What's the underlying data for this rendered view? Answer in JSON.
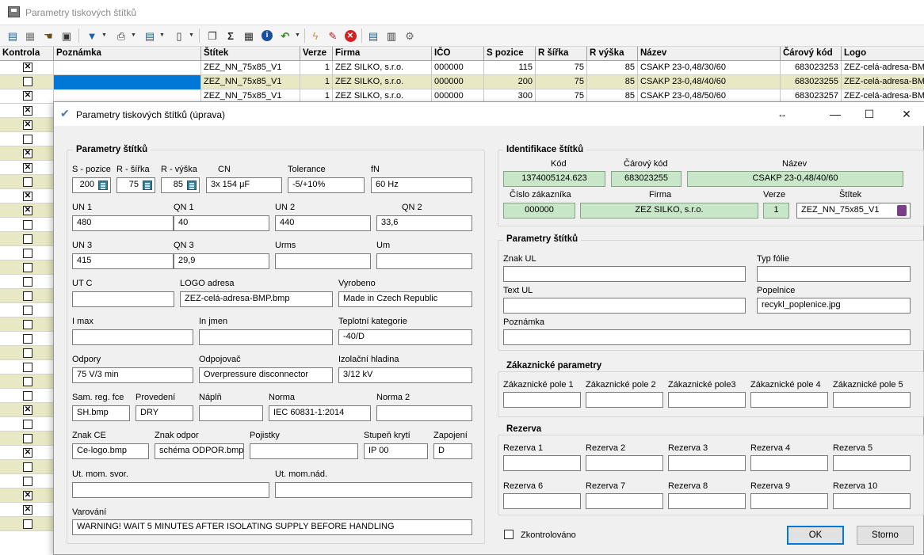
{
  "main_window": {
    "title": "Parametry tiskových štítků"
  },
  "toolbar": {
    "icons": [
      "add-icon",
      "table-icon",
      "hand-icon",
      "window-icon",
      "filter-icon",
      "print-icon",
      "layers-icon",
      "document-icon",
      "copy-icon",
      "sum-icon",
      "grid-icon",
      "info-icon",
      "undo-icon",
      "lightning-icon",
      "eraser-icon",
      "delete-icon",
      "tree-icon",
      "report-icon",
      "settings-icon"
    ]
  },
  "grid": {
    "columns": [
      "Kontrola",
      "Poznámka",
      "Štítek",
      "Verze",
      "Firma",
      "IČO",
      "S pozice",
      "R šířka",
      "R výška",
      "Název",
      "Čárový kód",
      "Logo"
    ],
    "rows": [
      {
        "checked": true,
        "note": "",
        "label": "ZEZ_NN_75x85_V1",
        "version": "1",
        "firm": "ZEZ SILKO, s.r.o.",
        "ico": "000000",
        "s_pos": "115",
        "r_width": "75",
        "r_height": "85",
        "name": "CSAKP 23-0,48/30/60",
        "barcode": "683023253",
        "logo": "ZEZ-celá-adresa-BMP"
      },
      {
        "checked": false,
        "note": "",
        "label": "ZEZ_NN_75x85_V1",
        "version": "1",
        "firm": "ZEZ SILKO, s.r.o.",
        "ico": "000000",
        "s_pos": "200",
        "r_width": "75",
        "r_height": "85",
        "name": "CSAKP 23-0,48/40/60",
        "barcode": "683023255",
        "logo": "ZEZ-celá-adresa-BMP"
      },
      {
        "checked": true,
        "note": "",
        "label": "ZEZ_NN_75x85_V1",
        "version": "1",
        "firm": "ZEZ SILKO, s.r.o.",
        "ico": "000000",
        "s_pos": "300",
        "r_width": "75",
        "r_height": "85",
        "name": "CSAKP 23-0,48/50/60",
        "barcode": "683023257",
        "logo": "ZEZ-celá-adresa-BMP"
      }
    ],
    "more_row_checks": [
      true,
      true,
      false,
      true,
      true,
      false,
      true,
      true,
      false,
      false,
      false,
      false,
      false,
      false,
      false,
      false,
      false,
      false,
      false,
      false,
      false,
      true,
      false,
      false,
      true,
      false,
      false,
      true,
      true,
      false
    ]
  },
  "dialog": {
    "title": "Parametry tiskových štítků (úprava)",
    "left": {
      "group_title": "Parametry štítků",
      "s_pos_label": "S - pozice",
      "s_pos": "200",
      "r_width_label": "R - šířka",
      "r_width": "75",
      "r_height_label": "R - výška",
      "r_height": "85",
      "cn_label": "CN",
      "cn": "3x 154 μF",
      "tolerance_label": "Tolerance",
      "tolerance": "-5/+10%",
      "fn_label": "fN",
      "fn": "60 Hz",
      "un1_label": "UN 1",
      "un1": "480",
      "qn1_label": "QN 1",
      "qn1": "40",
      "un2_label": "UN 2",
      "un2": "440",
      "qn2_label": "QN 2",
      "qn2": "33,6",
      "un3_label": "UN 3",
      "un3": "415",
      "qn3_label": "QN 3",
      "qn3": "29,9",
      "urms_label": "Urms",
      "urms": "",
      "um_label": "Um",
      "um": "",
      "utc_label": "UT C",
      "utc": "",
      "logo_label": "LOGO adresa",
      "logo": "ZEZ-celá-adresa-BMP.bmp",
      "made_label": "Vyrobeno",
      "made": "Made in Czech Republic",
      "imax_label": "I max",
      "imax": "",
      "injmen_label": "In jmen",
      "injmen": "",
      "tempcat_label": "Teplotní kategorie",
      "tempcat": "-40/D",
      "odpory_label": "Odpory",
      "odpory": "75 V/3 min",
      "odpojovac_label": "Odpojovač",
      "odpojovac": "Overpressure disconnector",
      "izolacni_label": "Izolační hladina",
      "izolacni": "3/12 kV",
      "samreg_label": "Sam. reg. fce",
      "samreg": "SH.bmp",
      "provedeni_label": "Provedení",
      "provedeni": "DRY",
      "napln_label": "Náplň",
      "napln": "",
      "norma_label": "Norma",
      "norma": "IEC 60831-1:2014",
      "norma2_label": "Norma 2",
      "norma2": "",
      "znakce_label": "Znak CE",
      "znakce": "Ce-logo.bmp",
      "znakodpor_label": "Znak odpor",
      "znakodpor": "schéma ODPOR.bmp",
      "pojistky_label": "Pojistky",
      "pojistky": "",
      "stupen_label": "Stupeň krytí",
      "stupen": "IP 00",
      "zapojeni_label": "Zapojení",
      "zapojeni": "D",
      "utmom_label": "Ut. mom. svor.",
      "utmom": "",
      "utmomnad_label": "Ut. mom.nád.",
      "utmomnad": "",
      "varovani_label": "Varování",
      "varovani": "WARNING! WAIT 5 MINUTES AFTER ISOLATING SUPPLY BEFORE HANDLING"
    },
    "ident": {
      "group_title": "Identifikace štítků",
      "kod_label": "Kód",
      "kod": "1374005124.623",
      "barcode_label": "Čárový kód",
      "barcode": "683023255",
      "nazev_label": "Název",
      "nazev": "CSAKP 23-0,48/40/60",
      "cislo_label": "Číslo zákazníka",
      "cislo": "000000",
      "firma_label": "Firma",
      "firma": "ZEZ SILKO, s.r.o.",
      "verze_label": "Verze",
      "verze": "1",
      "stitek_label": "Štítek",
      "stitek": "ZEZ_NN_75x85_V1"
    },
    "params": {
      "group_title": "Parametry štítků",
      "znakul_label": "Znak UL",
      "znakul": "",
      "typfolie_label": "Typ fólie",
      "typfolie": "",
      "textul_label": "Text UL",
      "textul": "",
      "popelnice_label": "Popelnice",
      "popelnice": "recykl_poplenice.jpg",
      "poznamka_label": "Poznámka",
      "poznamka": ""
    },
    "customer": {
      "group_title": "Zákaznické parametry",
      "fields": [
        "Zákaznické pole 1",
        "Zákaznické pole 2",
        "Zákaznické pole3",
        "Zákaznické pole 4",
        "Zákaznické pole 5"
      ]
    },
    "reserve": {
      "group_title": "Rezerva",
      "fields": [
        "Rezerva 1",
        "Rezerva 2",
        "Rezerva 3",
        "Rezerva 4",
        "Rezerva 5",
        "Rezerva 6",
        "Rezerva 7",
        "Rezerva 8",
        "Rezerva 9",
        "Rezerva 10"
      ]
    },
    "checked_label": "Zkontrolováno",
    "ok_label": "OK",
    "cancel_label": "Storno"
  }
}
